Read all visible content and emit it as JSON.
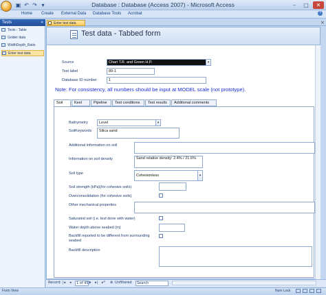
{
  "app": {
    "title": "Database : Database (Access 2007) - Microsoft Access",
    "quick_access": [
      "save-icon",
      "undo-icon",
      "redo-icon",
      "dropdown-icon"
    ],
    "window_buttons": [
      "minimize",
      "maximize",
      "close"
    ]
  },
  "ribbon": {
    "tabs": [
      "Home",
      "Create",
      "External Data",
      "Database Tools",
      "Acrobat"
    ]
  },
  "nav": {
    "header": "Tests",
    "chevron": "«",
    "items": [
      {
        "label": "Tests : Table",
        "selected": false
      },
      {
        "label": "Golder data",
        "selected": false
      },
      {
        "label": "WidthDepth_Ratio",
        "selected": false
      },
      {
        "label": "Enter test data",
        "selected": true
      }
    ]
  },
  "document": {
    "tab_label": "Enter test data",
    "close_glyph": "×"
  },
  "form": {
    "title": "Test data  - Tabbed form",
    "fields": {
      "source": {
        "label": "Source",
        "value": "Chari T.R. and Green H.P."
      },
      "test_label": {
        "label": "Test label",
        "value": "89-1"
      },
      "db_id": {
        "label": "Database ID number",
        "value": "1"
      }
    },
    "note": "Note: For consistency, all numbers should be input at MODEL scale (not prototype).",
    "tabs": [
      "Soil",
      "Keel",
      "Pipeline",
      "Test conditions",
      "Test results",
      "Additional comments"
    ],
    "active_tab": "Soil",
    "soil": {
      "bathymetry": {
        "label": "Bathymetry",
        "value": "Level"
      },
      "soil_keywords": {
        "label": "SoilKeywords",
        "value": "Silica sand"
      },
      "additional_info": {
        "label": "Additional information on soil",
        "value": ""
      },
      "density_info": {
        "label": "Information on soil density",
        "value": "Sand relative density: 2.4% / 21.6%"
      },
      "soil_type": {
        "label": "Soil type",
        "value": "Cohesionless"
      },
      "soil_strength": {
        "label": "Soil strength (kPa)(for cohesive soils)",
        "value": ""
      },
      "overconsolidation": {
        "label": "Overconsolidation (for cohesive soils)",
        "checked": false
      },
      "other_mech": {
        "label": "Other mechanical properties",
        "value": ""
      },
      "saturated": {
        "label": "Saturated soil (i.e. test done with water)",
        "checked": false
      },
      "water_depth": {
        "label": "Water depth above seabed (m)",
        "value": ""
      },
      "backfill_diff": {
        "label": "Backfill reported to be different from surrounding seabed",
        "checked": false
      },
      "backfill_desc": {
        "label": "Backfill description",
        "value": ""
      }
    }
  },
  "record_nav": {
    "label": "Record:",
    "first": "|◂",
    "prev": "◂",
    "position": "1 of 457",
    "next": "▸",
    "last": "▸|",
    "new": "▸*",
    "filter": "Unfiltered",
    "search": "Search"
  },
  "status": {
    "left": "Form View",
    "right": "Num Lock"
  }
}
